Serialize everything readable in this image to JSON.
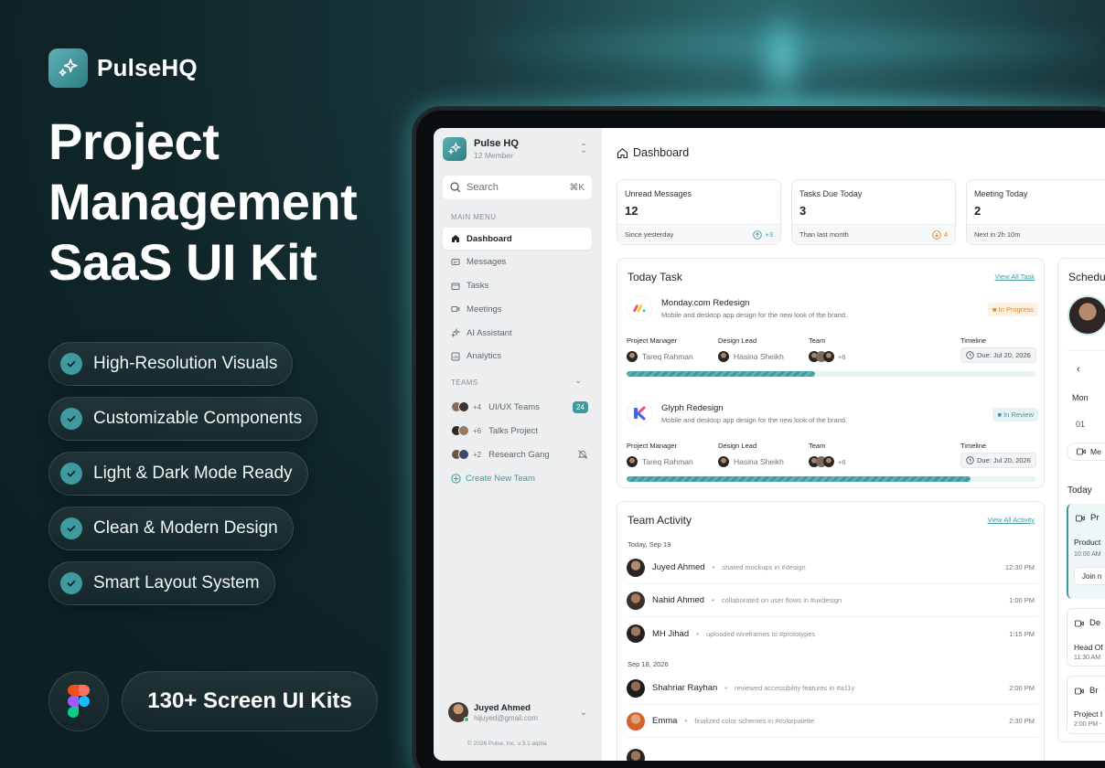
{
  "brand": {
    "name": "PulseHQ"
  },
  "hero": {
    "line1": "Project",
    "line2": "Management",
    "line3": "SaaS UI Kit"
  },
  "features": [
    "High-Resolution Visuals",
    "Customizable Components",
    "Light & Dark Mode Ready",
    "Clean & Modern Design",
    "Smart Layout System"
  ],
  "kits_label": "130+ Screen UI Kits",
  "colors": {
    "accent": "#3f9aa0",
    "background": "#0f2528",
    "orange": "#e0862a"
  },
  "app": {
    "workspace": {
      "name": "Pulse HQ",
      "members": "12 Member"
    },
    "search": {
      "placeholder": "Search",
      "shortcut": "⌘K"
    },
    "main_menu_label": "MAIN MENU",
    "nav": [
      "Dashboard",
      "Messages",
      "Tasks",
      "Meetings",
      "AI Assistant",
      "Analytics"
    ],
    "teams_label": "TEAMS",
    "teams": [
      {
        "plus": "+4",
        "name": "UI/UX Teams",
        "badge": "24"
      },
      {
        "plus": "+6",
        "name": "Talks Project",
        "badge": ""
      },
      {
        "plus": "+2",
        "name": "Research Gang",
        "badge": ""
      }
    ],
    "create_team": "Create New Team",
    "user": {
      "name": "Juyed Ahmed",
      "email": "hijuyed@gmail.com"
    },
    "copyright": "© 2026 Pulse, Inc. v.3.1-alpha",
    "breadcrumb": "Dashboard",
    "stats": [
      {
        "label": "Unread Messages",
        "value": "12",
        "foot": "Since yesterday",
        "delta": "+3",
        "icon": "arrow-up-icon"
      },
      {
        "label": "Tasks Due Today",
        "value": "3",
        "foot": "Than last month",
        "delta": "4",
        "icon": "arrow-down-icon"
      },
      {
        "label": "Meeting Today",
        "value": "2",
        "foot": "Next in 2h 10m",
        "delta": "",
        "icon": ""
      }
    ],
    "today_task": {
      "title": "Today Task",
      "link": "View All Task",
      "labels": {
        "pm": "Project Manager",
        "lead": "Design Lead",
        "team": "Team",
        "timeline": "Timeline"
      },
      "tasks": [
        {
          "name": "Monday.com Redesign",
          "desc": "Mobile and desktop app design for the new look of the brand.",
          "status": "In Progress",
          "pm": "Tareq Rahman",
          "lead": "Hasina Sheikh",
          "team_plus": "+6",
          "due": "Due: Jul 20, 2026",
          "progress": 0.46
        },
        {
          "name": "Glyph Redesign",
          "desc": "Mobile and desktop app design for the new look of the brand.",
          "status": "In Review",
          "pm": "Tareq Rahman",
          "lead": "Hasina Sheikh",
          "team_plus": "+6",
          "due": "Due: Jul 20, 2026",
          "progress": 0.84
        }
      ]
    },
    "team_activity": {
      "title": "Team Activity",
      "link": "View All Activity",
      "day1": "Today, Sep 19",
      "day2": "Sep 18, 2026",
      "items": [
        {
          "name": "Juyed Ahmed",
          "text": "shared mockups in #design",
          "time": "12:30 PM"
        },
        {
          "name": "Nahid Ahmed",
          "text": "collaborated on user flows in #uxdesign",
          "time": "1:00 PM"
        },
        {
          "name": "MH Jihad",
          "text": "uploaded wireframes to #prototypes",
          "time": "1:15 PM"
        },
        {
          "name": "Shahriar Rayhan",
          "text": "reviewed accessibility features in #a11y",
          "time": "2:00 PM"
        },
        {
          "name": "Emma",
          "text": "finalized color schemes in #colorpalette",
          "time": "2:30 PM"
        }
      ]
    },
    "schedule": {
      "title": "Schedu",
      "day": "Mon",
      "date": "01",
      "btn": "Me",
      "today": "Today",
      "event1": {
        "title": "Pr",
        "sub": "Product",
        "time": "10:00 AM",
        "join": "Join n"
      },
      "event2": {
        "title": "De",
        "sub": "Head Of",
        "time": "11:30 AM"
      },
      "event3": {
        "title": "Br",
        "sub": "Project I",
        "time": "2:00 PM -"
      }
    }
  }
}
